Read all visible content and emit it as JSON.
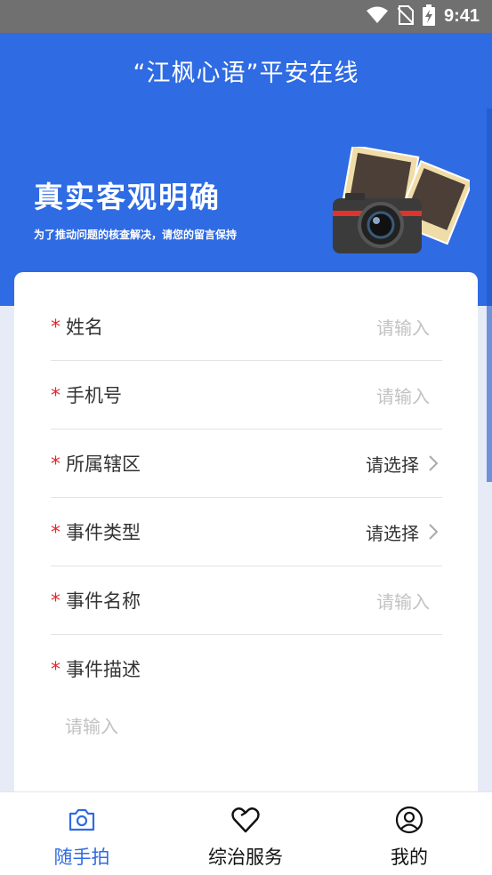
{
  "status_bar": {
    "time": "9:41"
  },
  "header": {
    "title": "“江枫心语”平安在线",
    "banner_title": "真实客观明确",
    "banner_subtitle": "为了推动问题的核查解决，请您的留言保持"
  },
  "form": {
    "fields": [
      {
        "label": "姓名",
        "value": "请输入",
        "type": "input"
      },
      {
        "label": "手机号",
        "value": "请输入",
        "type": "input"
      },
      {
        "label": "所属辖区",
        "value": "请选择",
        "type": "select"
      },
      {
        "label": "事件类型",
        "value": "请选择",
        "type": "select"
      },
      {
        "label": "事件名称",
        "value": "请输入",
        "type": "input"
      }
    ],
    "description": {
      "label": "事件描述",
      "placeholder": "请输入"
    },
    "required_mark": "*"
  },
  "tabs": [
    {
      "label": "随手拍",
      "icon": "camera-icon",
      "active": true
    },
    {
      "label": "综治服务",
      "icon": "heart-icon",
      "active": false
    },
    {
      "label": "我的",
      "icon": "user-icon",
      "active": false
    }
  ],
  "colors": {
    "primary": "#2f6be3",
    "required": "#e8242b"
  }
}
